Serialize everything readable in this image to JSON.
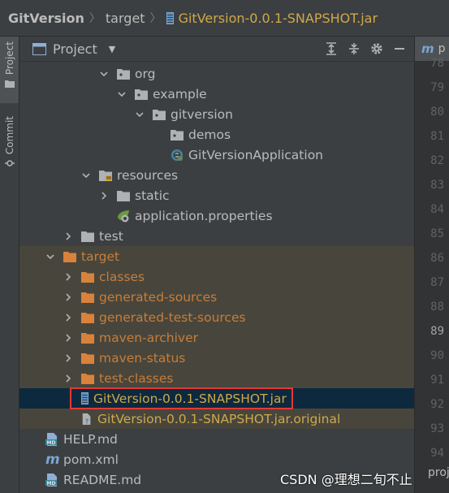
{
  "breadcrumb": {
    "project": "GitVersion",
    "folder": "target",
    "file": "GitVersion-0.0.1-SNAPSHOT.jar"
  },
  "side_tabs": {
    "project": "Project",
    "commit": "Commit"
  },
  "panel": {
    "title": "Project"
  },
  "tree": [
    {
      "label": "org",
      "icon": "package-folder-icon",
      "chevron": "down",
      "color": "default",
      "excluded": false
    },
    {
      "label": "example",
      "icon": "package-folder-icon",
      "chevron": "down",
      "color": "default",
      "excluded": false
    },
    {
      "label": "gitversion",
      "icon": "package-folder-icon",
      "chevron": "down",
      "color": "default",
      "excluded": false
    },
    {
      "label": "demos",
      "icon": "package-folder-icon",
      "chevron": "none",
      "color": "default",
      "excluded": false
    },
    {
      "label": "GitVersionApplication",
      "icon": "spring-class-icon",
      "chevron": "none",
      "color": "default",
      "excluded": false
    },
    {
      "label": "resources",
      "icon": "resources-folder-icon",
      "chevron": "down",
      "color": "default",
      "excluded": false
    },
    {
      "label": "static",
      "icon": "folder-icon",
      "chevron": "right",
      "color": "default",
      "excluded": false
    },
    {
      "label": "application.properties",
      "icon": "spring-properties-icon",
      "chevron": "none",
      "color": "default",
      "excluded": false
    },
    {
      "label": "test",
      "icon": "folder-icon",
      "chevron": "right",
      "color": "default",
      "excluded": false
    },
    {
      "label": "target",
      "icon": "orange-folder-icon",
      "chevron": "down",
      "color": "orange",
      "excluded": true
    },
    {
      "label": "classes",
      "icon": "orange-folder-icon",
      "chevron": "right",
      "color": "orange",
      "excluded": true
    },
    {
      "label": "generated-sources",
      "icon": "orange-folder-icon",
      "chevron": "right",
      "color": "orange",
      "excluded": true
    },
    {
      "label": "generated-test-sources",
      "icon": "orange-folder-icon",
      "chevron": "right",
      "color": "orange",
      "excluded": true
    },
    {
      "label": "maven-archiver",
      "icon": "orange-folder-icon",
      "chevron": "right",
      "color": "orange",
      "excluded": true
    },
    {
      "label": "maven-status",
      "icon": "orange-folder-icon",
      "chevron": "right",
      "color": "orange",
      "excluded": true
    },
    {
      "label": "test-classes",
      "icon": "orange-folder-icon",
      "chevron": "right",
      "color": "orange",
      "excluded": true
    },
    {
      "label": "GitVersion-0.0.1-SNAPSHOT.jar",
      "icon": "jar-icon",
      "chevron": "none",
      "color": "gold",
      "excluded": false,
      "selected": true
    },
    {
      "label": "GitVersion-0.0.1-SNAPSHOT.jar.original",
      "icon": "unknown-file-icon",
      "chevron": "none",
      "color": "gold",
      "excluded": true
    },
    {
      "label": "HELP.md",
      "icon": "markdown-icon",
      "chevron": "none",
      "color": "default",
      "excluded": false
    },
    {
      "label": "pom.xml",
      "icon": "maven-icon",
      "chevron": "none",
      "color": "default",
      "excluded": false
    },
    {
      "label": "README.md",
      "icon": "markdown-icon",
      "chevron": "none",
      "color": "default",
      "excluded": false
    }
  ],
  "editor": {
    "tab_icon": "m",
    "tab_fragment": "p",
    "line_numbers": [
      "78",
      "79",
      "80",
      "81",
      "82",
      "83",
      "84",
      "85",
      "86",
      "87",
      "88",
      "89",
      "90",
      "91",
      "92",
      "93",
      "94"
    ],
    "current_line": "89",
    "bottom_fragment": "proj"
  },
  "watermark": "CSDN @理想二旬不止",
  "colors": {
    "background": "#3c3f41",
    "excluded_row": "#48463c",
    "selected_row": "#0d293e",
    "highlight_box": "#e53935",
    "orange_text": "#c77d3a",
    "gold_text": "#d0a84a"
  }
}
